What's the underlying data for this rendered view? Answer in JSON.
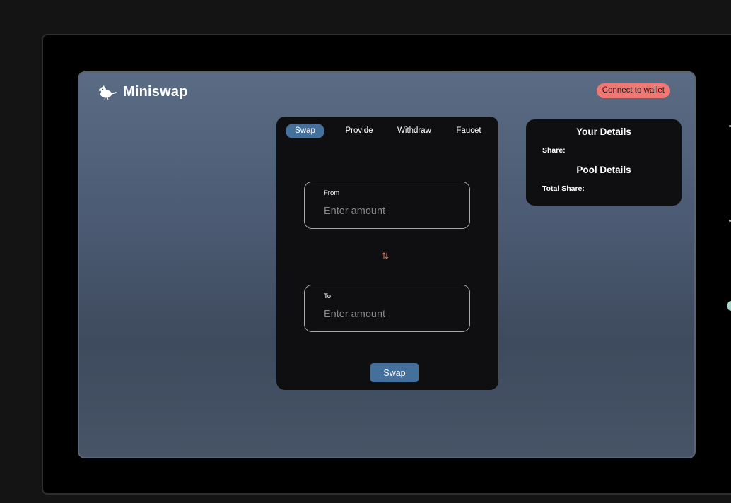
{
  "app": {
    "name": "Miniswap",
    "logo_icon": "bird-logo-icon"
  },
  "header": {
    "connect_label": "Connect to wallet",
    "connect_color": "#f07874"
  },
  "swap_card": {
    "tabs": [
      {
        "label": "Swap",
        "active": true
      },
      {
        "label": "Provide",
        "active": false
      },
      {
        "label": "Withdraw",
        "active": false
      },
      {
        "label": "Faucet",
        "active": false
      }
    ],
    "from": {
      "label": "From",
      "placeholder": "Enter amount",
      "value": ""
    },
    "to": {
      "label": "To",
      "placeholder": "Enter amount",
      "value": ""
    },
    "direction_icon": "swap-direction-icon",
    "swap_button_label": "Swap",
    "accent_color": "#46709c"
  },
  "details_card": {
    "your_title": "Your Details",
    "share_label": "Share:",
    "pool_title": "Pool Details",
    "total_share_label": "Total Share:"
  }
}
